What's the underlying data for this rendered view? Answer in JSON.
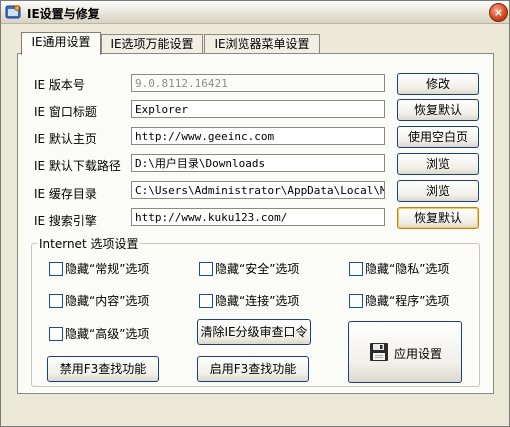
{
  "window": {
    "title": "IE设置与修复",
    "close_glyph": "×"
  },
  "tabs": [
    {
      "label": "IE通用设置"
    },
    {
      "label": "IE选项万能设置"
    },
    {
      "label": "IE浏览器菜单设置"
    }
  ],
  "settings": [
    {
      "label": "IE 版本号",
      "value": "9.0.8112.16421",
      "button": "修改"
    },
    {
      "label": "IE 窗口标题",
      "value": "Explorer",
      "button": "恢复默认"
    },
    {
      "label": "IE 默认主页",
      "value": "http://www.geeinc.com",
      "button": "使用空白页"
    },
    {
      "label": "IE 默认下载路径",
      "value": "D:\\用户目录\\Downloads",
      "button": "浏览"
    },
    {
      "label": "IE 缓存目录",
      "value": "C:\\Users\\Administrator\\AppData\\Local\\Microsoft",
      "button": "浏览"
    },
    {
      "label": "IE 搜索引擎",
      "value": "http://www.kuku123.com/",
      "button": "恢复默认"
    }
  ],
  "internet_options": {
    "title": "Internet 选项设置",
    "checkboxes": [
      {
        "label": "隐藏“常规”选项",
        "checked": false
      },
      {
        "label": "隐藏“安全”选项",
        "checked": false
      },
      {
        "label": "隐藏“隐私”选项",
        "checked": false
      },
      {
        "label": "隐藏“内容”选项",
        "checked": false
      },
      {
        "label": "隐藏“连接”选项",
        "checked": false
      },
      {
        "label": "隐藏“程序”选项",
        "checked": false
      },
      {
        "label": "隐藏“高级”选项",
        "checked": false
      }
    ],
    "clear_ie_password_button": "清除IE分级审查口令",
    "disable_f3_button": "禁用F3查找功能",
    "enable_f3_button": "启用F3查找功能",
    "apply_button": "应用设置"
  },
  "icons": {
    "app": "ie-tool-icon",
    "apply": "floppy-disk-icon",
    "close": "close-icon"
  },
  "colors": {
    "button_border": "#1c3f7a",
    "close_button": "#d4431c",
    "field_border": "#8c8a80"
  }
}
